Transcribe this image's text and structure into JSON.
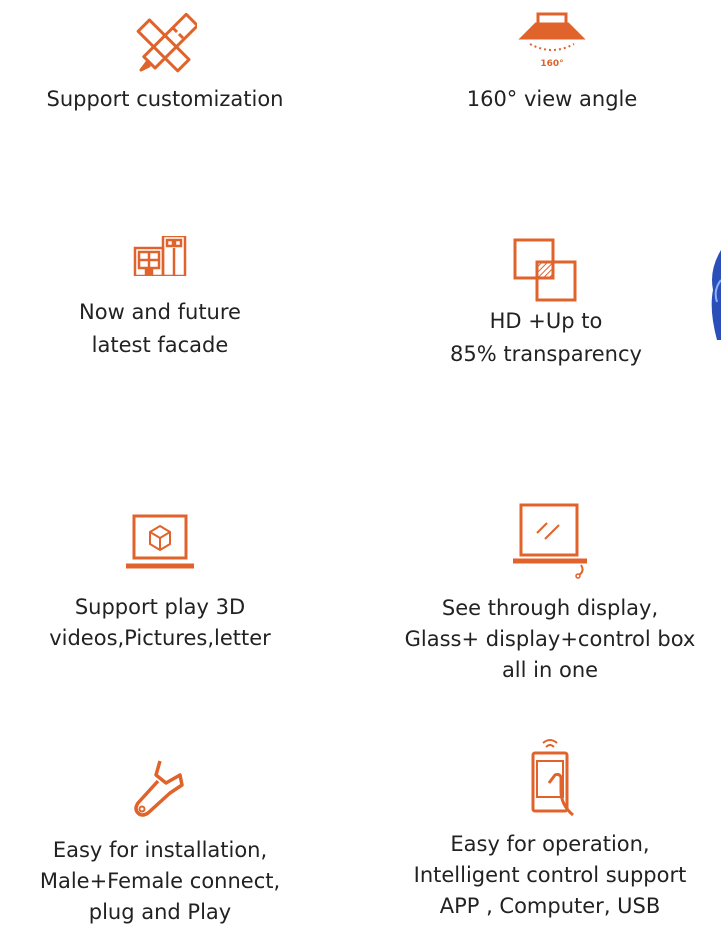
{
  "colors": {
    "accent": "#e0632c",
    "text": "#222222",
    "deco": "#2a4fb8"
  },
  "features": [
    {
      "icon": "pencil-ruler-icon",
      "label": "Support customization"
    },
    {
      "icon": "view-angle-icon",
      "angle_label": "160°",
      "label": "160° view angle"
    },
    {
      "icon": "building-facade-icon",
      "lines": [
        "Now and future",
        "latest facade"
      ]
    },
    {
      "icon": "transparency-icon",
      "lines": [
        "HD +Up to",
        "85% transparency"
      ]
    },
    {
      "icon": "3d-laptop-icon",
      "lines": [
        "Support play 3D",
        "videos,Pictures,letter"
      ]
    },
    {
      "icon": "see-through-display-icon",
      "lines": [
        "See through display,",
        "Glass+ display+control box",
        "all in one"
      ]
    },
    {
      "icon": "wrench-icon",
      "lines": [
        "Easy for installation,",
        "Male+Female connect,",
        "plug and Play"
      ]
    },
    {
      "icon": "phone-control-icon",
      "lines": [
        "Easy for operation,",
        "Intelligent control support",
        "APP , Computer, USB"
      ]
    }
  ]
}
